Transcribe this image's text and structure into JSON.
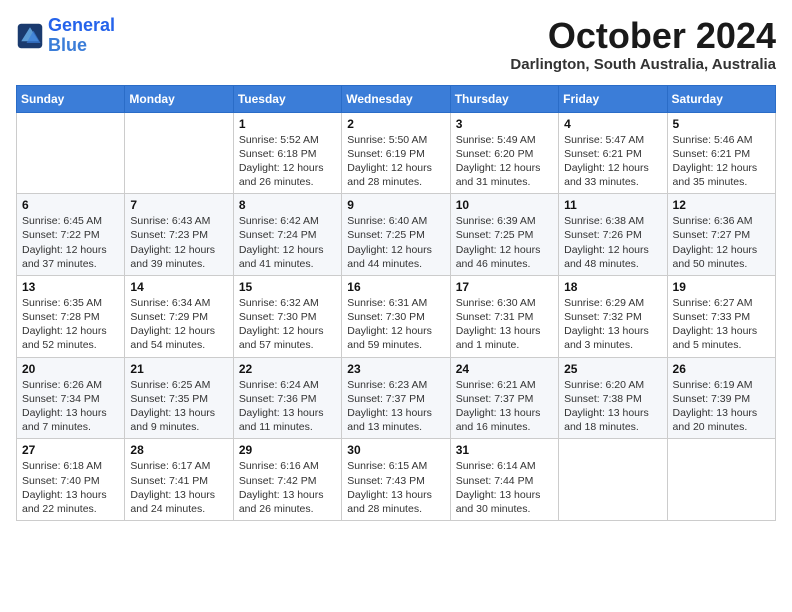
{
  "logo": {
    "line1": "General",
    "line2": "Blue"
  },
  "title": "October 2024",
  "location": "Darlington, South Australia, Australia",
  "weekdays": [
    "Sunday",
    "Monday",
    "Tuesday",
    "Wednesday",
    "Thursday",
    "Friday",
    "Saturday"
  ],
  "weeks": [
    [
      null,
      null,
      {
        "day": 1,
        "sunrise": "5:52 AM",
        "sunset": "6:18 PM",
        "daylight": "12 hours and 26 minutes."
      },
      {
        "day": 2,
        "sunrise": "5:50 AM",
        "sunset": "6:19 PM",
        "daylight": "12 hours and 28 minutes."
      },
      {
        "day": 3,
        "sunrise": "5:49 AM",
        "sunset": "6:20 PM",
        "daylight": "12 hours and 31 minutes."
      },
      {
        "day": 4,
        "sunrise": "5:47 AM",
        "sunset": "6:21 PM",
        "daylight": "12 hours and 33 minutes."
      },
      {
        "day": 5,
        "sunrise": "5:46 AM",
        "sunset": "6:21 PM",
        "daylight": "12 hours and 35 minutes."
      }
    ],
    [
      {
        "day": 6,
        "sunrise": "6:45 AM",
        "sunset": "7:22 PM",
        "daylight": "12 hours and 37 minutes."
      },
      {
        "day": 7,
        "sunrise": "6:43 AM",
        "sunset": "7:23 PM",
        "daylight": "12 hours and 39 minutes."
      },
      {
        "day": 8,
        "sunrise": "6:42 AM",
        "sunset": "7:24 PM",
        "daylight": "12 hours and 41 minutes."
      },
      {
        "day": 9,
        "sunrise": "6:40 AM",
        "sunset": "7:25 PM",
        "daylight": "12 hours and 44 minutes."
      },
      {
        "day": 10,
        "sunrise": "6:39 AM",
        "sunset": "7:25 PM",
        "daylight": "12 hours and 46 minutes."
      },
      {
        "day": 11,
        "sunrise": "6:38 AM",
        "sunset": "7:26 PM",
        "daylight": "12 hours and 48 minutes."
      },
      {
        "day": 12,
        "sunrise": "6:36 AM",
        "sunset": "7:27 PM",
        "daylight": "12 hours and 50 minutes."
      }
    ],
    [
      {
        "day": 13,
        "sunrise": "6:35 AM",
        "sunset": "7:28 PM",
        "daylight": "12 hours and 52 minutes."
      },
      {
        "day": 14,
        "sunrise": "6:34 AM",
        "sunset": "7:29 PM",
        "daylight": "12 hours and 54 minutes."
      },
      {
        "day": 15,
        "sunrise": "6:32 AM",
        "sunset": "7:30 PM",
        "daylight": "12 hours and 57 minutes."
      },
      {
        "day": 16,
        "sunrise": "6:31 AM",
        "sunset": "7:30 PM",
        "daylight": "12 hours and 59 minutes."
      },
      {
        "day": 17,
        "sunrise": "6:30 AM",
        "sunset": "7:31 PM",
        "daylight": "13 hours and 1 minute."
      },
      {
        "day": 18,
        "sunrise": "6:29 AM",
        "sunset": "7:32 PM",
        "daylight": "13 hours and 3 minutes."
      },
      {
        "day": 19,
        "sunrise": "6:27 AM",
        "sunset": "7:33 PM",
        "daylight": "13 hours and 5 minutes."
      }
    ],
    [
      {
        "day": 20,
        "sunrise": "6:26 AM",
        "sunset": "7:34 PM",
        "daylight": "13 hours and 7 minutes."
      },
      {
        "day": 21,
        "sunrise": "6:25 AM",
        "sunset": "7:35 PM",
        "daylight": "13 hours and 9 minutes."
      },
      {
        "day": 22,
        "sunrise": "6:24 AM",
        "sunset": "7:36 PM",
        "daylight": "13 hours and 11 minutes."
      },
      {
        "day": 23,
        "sunrise": "6:23 AM",
        "sunset": "7:37 PM",
        "daylight": "13 hours and 13 minutes."
      },
      {
        "day": 24,
        "sunrise": "6:21 AM",
        "sunset": "7:37 PM",
        "daylight": "13 hours and 16 minutes."
      },
      {
        "day": 25,
        "sunrise": "6:20 AM",
        "sunset": "7:38 PM",
        "daylight": "13 hours and 18 minutes."
      },
      {
        "day": 26,
        "sunrise": "6:19 AM",
        "sunset": "7:39 PM",
        "daylight": "13 hours and 20 minutes."
      }
    ],
    [
      {
        "day": 27,
        "sunrise": "6:18 AM",
        "sunset": "7:40 PM",
        "daylight": "13 hours and 22 minutes."
      },
      {
        "day": 28,
        "sunrise": "6:17 AM",
        "sunset": "7:41 PM",
        "daylight": "13 hours and 24 minutes."
      },
      {
        "day": 29,
        "sunrise": "6:16 AM",
        "sunset": "7:42 PM",
        "daylight": "13 hours and 26 minutes."
      },
      {
        "day": 30,
        "sunrise": "6:15 AM",
        "sunset": "7:43 PM",
        "daylight": "13 hours and 28 minutes."
      },
      {
        "day": 31,
        "sunrise": "6:14 AM",
        "sunset": "7:44 PM",
        "daylight": "13 hours and 30 minutes."
      },
      null,
      null
    ]
  ]
}
